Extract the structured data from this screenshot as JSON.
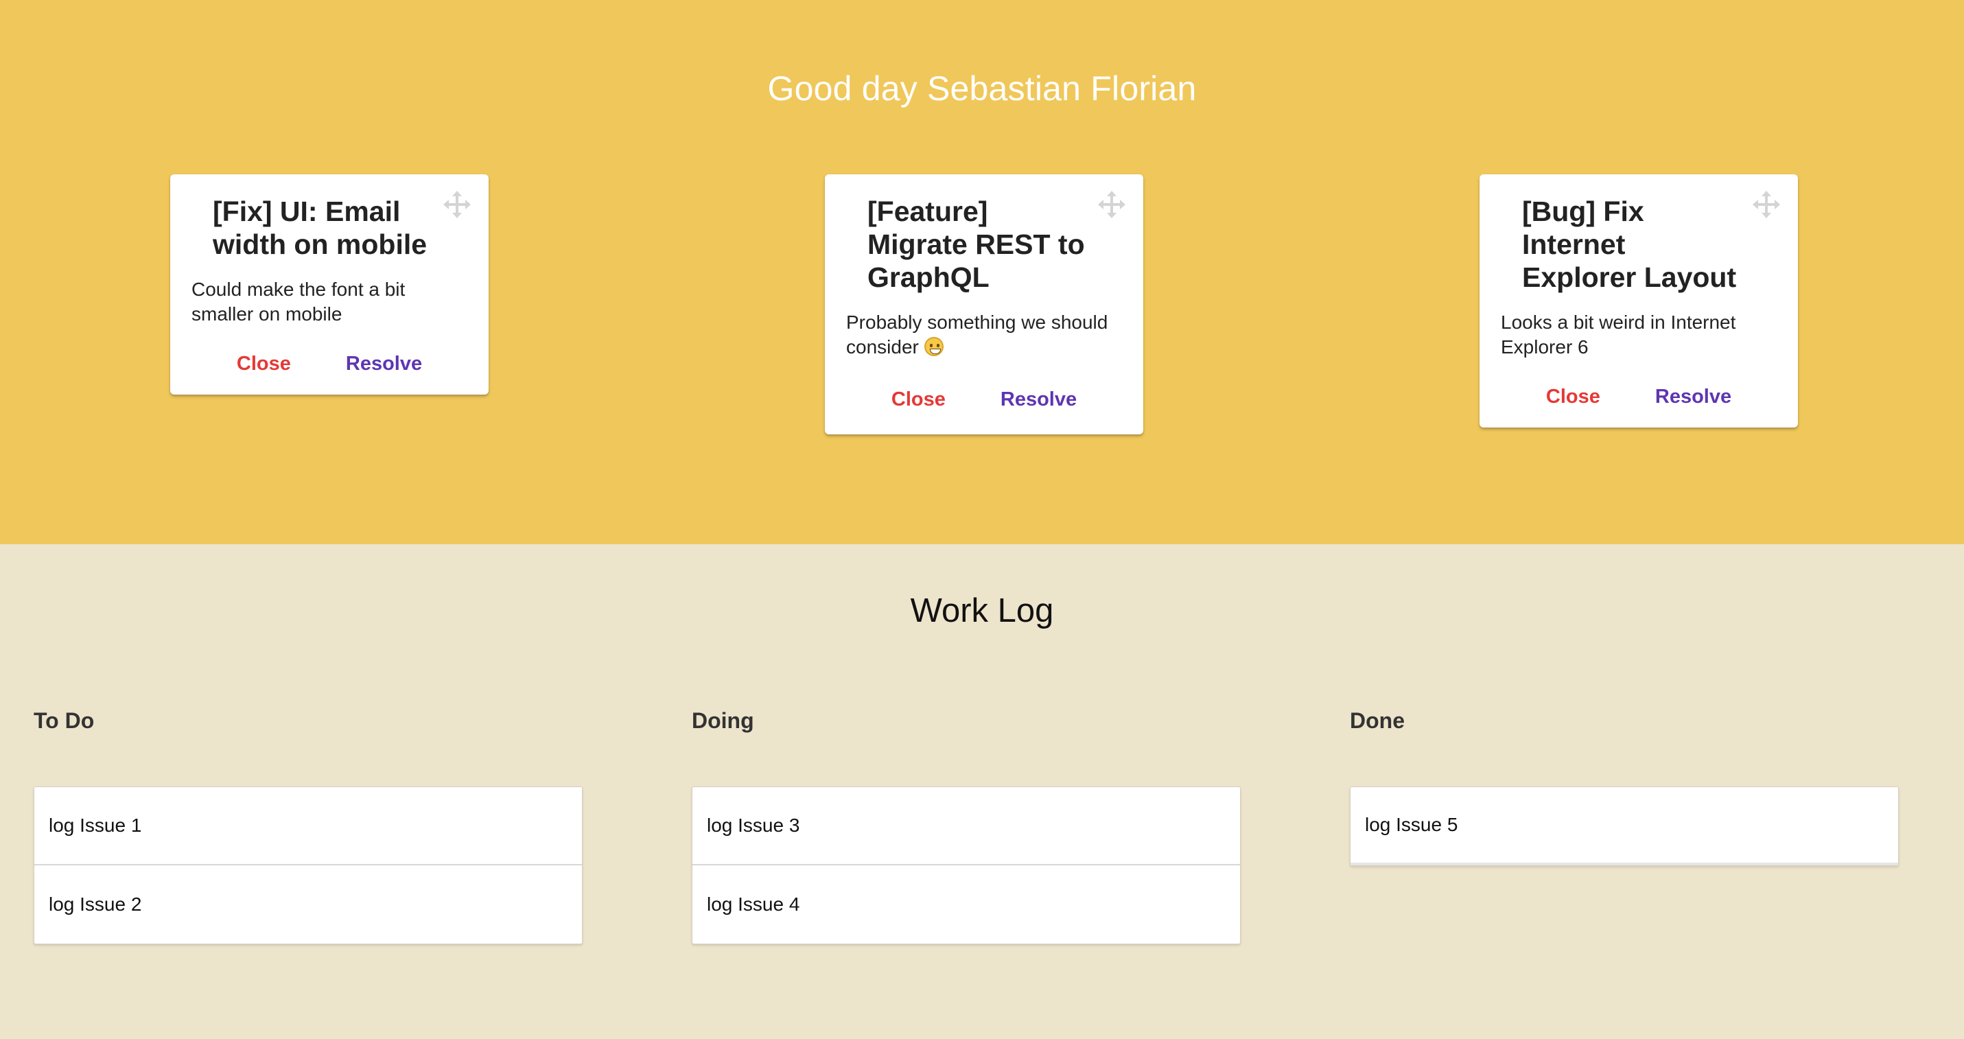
{
  "greeting": "Good day Sebastian Florian",
  "cards": [
    {
      "title": "[Fix] UI: Email width on mobile",
      "description": "Could make the font a bit smaller on mobile",
      "close_label": "Close",
      "resolve_label": "Resolve",
      "icon": "move-icon"
    },
    {
      "title": "[Feature] Migrate REST to GraphQL",
      "description": "Probably something we should consider",
      "emoji": "grinning-face",
      "close_label": "Close",
      "resolve_label": "Resolve",
      "icon": "move-icon"
    },
    {
      "title": "[Bug] Fix Internet Explorer Layout",
      "description": "Looks a bit weird in Internet Explorer 6",
      "close_label": "Close",
      "resolve_label": "Resolve",
      "icon": "move-icon"
    }
  ],
  "worklog": {
    "title": "Work Log",
    "columns": [
      {
        "heading": "To Do",
        "items": [
          "log Issue 1",
          "log Issue 2"
        ]
      },
      {
        "heading": "Doing",
        "items": [
          "log Issue 3",
          "log Issue 4"
        ]
      },
      {
        "heading": "Done",
        "items": [
          "log Issue 5"
        ]
      }
    ]
  },
  "colors": {
    "hero_background": "#f0c75a",
    "page_background": "#ede4cc",
    "close": "#e53935",
    "resolve": "#5e35b1"
  }
}
